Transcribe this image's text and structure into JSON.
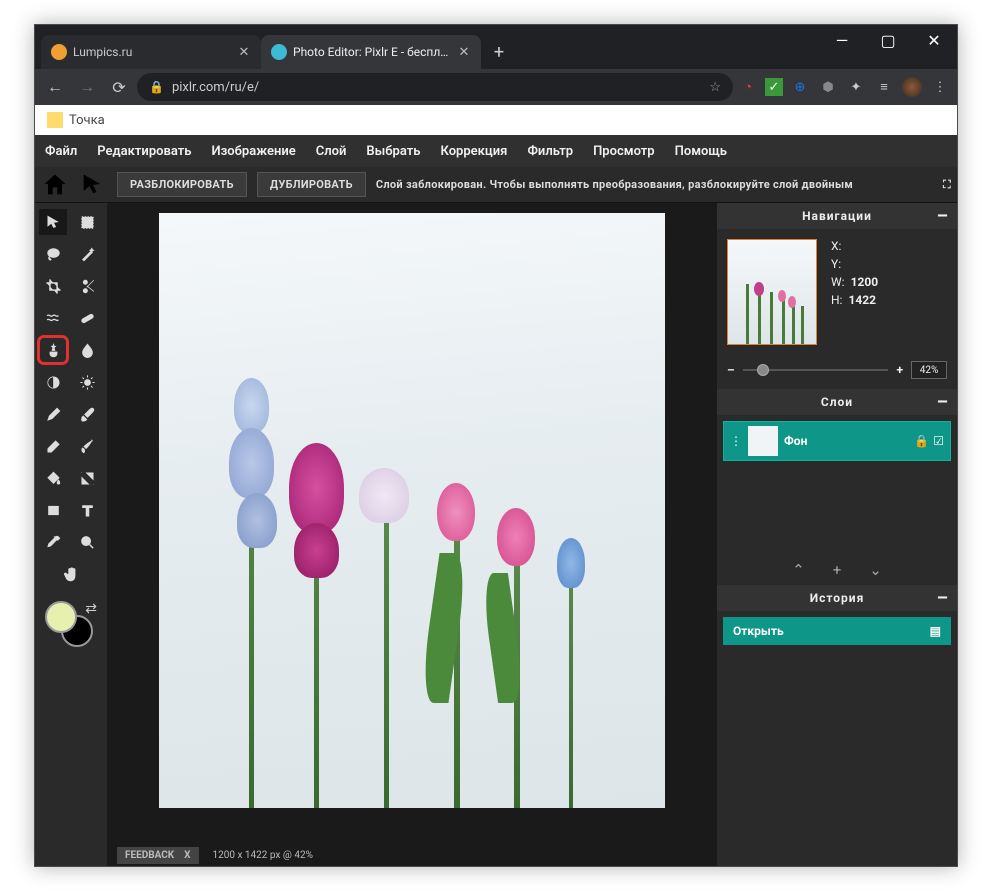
{
  "browser": {
    "tabs": [
      {
        "title": "Lumpics.ru",
        "favicon": "#f0a030"
      },
      {
        "title": "Photo Editor: Pixlr E - бесплатны",
        "favicon": "#3cbcd4"
      }
    ],
    "url": "pixlr.com/ru/e/"
  },
  "bookmark": {
    "label": "Точка"
  },
  "menu": [
    "Файл",
    "Редактировать",
    "Изображение",
    "Слой",
    "Выбрать",
    "Коррекция",
    "Фильтр",
    "Просмотр",
    "Помощь"
  ],
  "options": {
    "unlock": "РАЗБЛОКИРОВАТЬ",
    "duplicate": "ДУБЛИРОВАТЬ",
    "msg": "Слой заблокирован. Чтобы выполнять преобразования, разблокируйте слой двойным"
  },
  "panels": {
    "nav": {
      "title": "Навигации",
      "x": "X:",
      "y": "Y:",
      "wlabel": "W:",
      "w": "1200",
      "hlabel": "H:",
      "h": "1422",
      "zoom": "42%"
    },
    "layers": {
      "title": "Слои",
      "layer": "Фон"
    },
    "history": {
      "title": "История",
      "item": "Открыть"
    }
  },
  "status": {
    "feedback": "FEEDBACK",
    "fbclose": "X",
    "dims": "1200 x 1422 px @ 42%"
  }
}
